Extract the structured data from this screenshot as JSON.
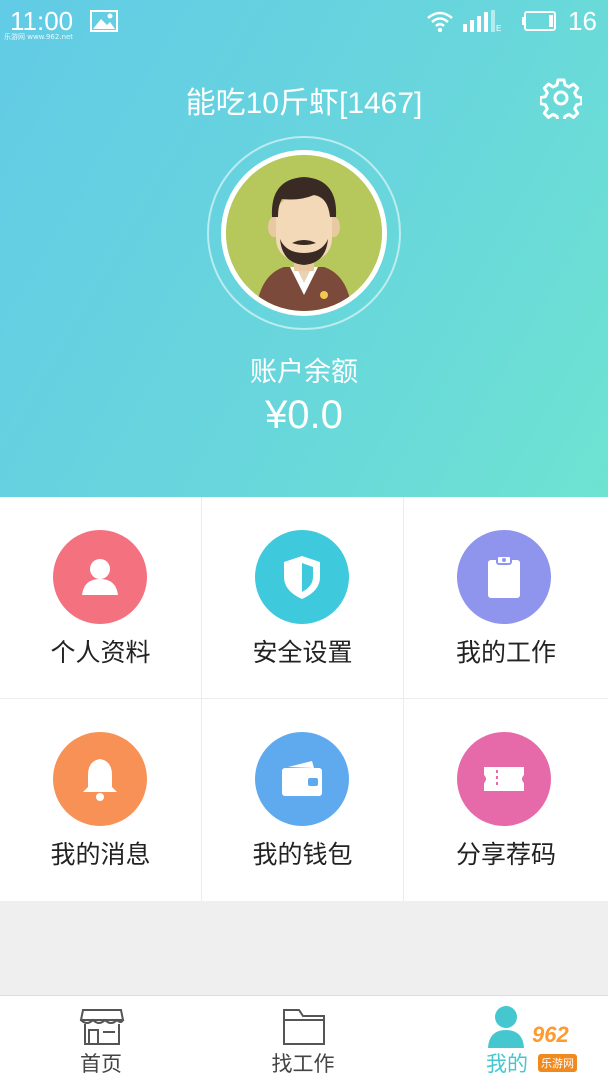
{
  "status_bar": {
    "time": "11:00",
    "battery_level": "16",
    "watermark_top": "乐游网 www.962.net"
  },
  "header": {
    "username": "能吃10斤虾[1467]",
    "balance_label": "账户余额",
    "balance_value": "¥0.0",
    "gradient_colors": [
      "#62cbe6",
      "#6ee3d2"
    ]
  },
  "menu": [
    {
      "label": "个人资料",
      "icon": "person-icon",
      "color": "#f4727f"
    },
    {
      "label": "安全设置",
      "icon": "shield-icon",
      "color": "#3fc9dc"
    },
    {
      "label": "我的工作",
      "icon": "clipboard-icon",
      "color": "#8f95ec"
    },
    {
      "label": "我的消息",
      "icon": "bell-icon",
      "color": "#f79155"
    },
    {
      "label": "我的钱包",
      "icon": "wallet-icon",
      "color": "#5faaee"
    },
    {
      "label": "分享荐码",
      "icon": "ticket-icon",
      "color": "#e66aa9"
    }
  ],
  "tabbar": {
    "tabs": [
      {
        "label": "首页",
        "icon": "shop-icon",
        "active": false
      },
      {
        "label": "找工作",
        "icon": "folder-icon",
        "active": false
      },
      {
        "label": "我的",
        "icon": "user-icon",
        "active": true
      }
    ],
    "active_color": "#45c7cf"
  },
  "watermark": {
    "number": "962",
    "subtitle": "乐游网"
  }
}
